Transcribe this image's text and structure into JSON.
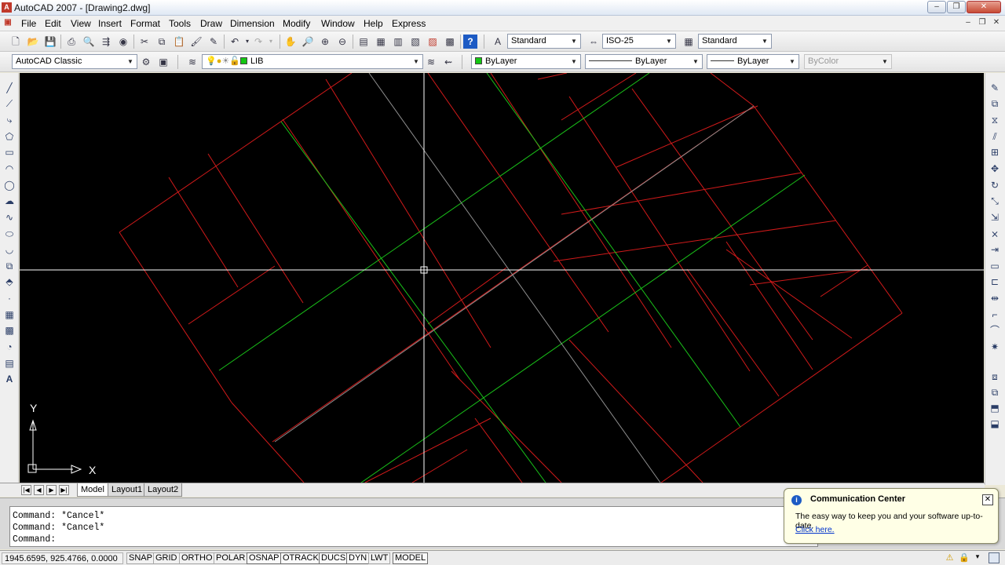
{
  "window": {
    "title": "AutoCAD 2007 - [Drawing2.dwg]",
    "app_icon_glyph": "A",
    "buttons": [
      "–",
      "❐",
      "✕"
    ],
    "mdi_buttons": [
      "–",
      "❐",
      "✕"
    ]
  },
  "menu": {
    "items": [
      "File",
      "Edit",
      "View",
      "Insert",
      "Format",
      "Tools",
      "Draw",
      "Dimension",
      "Modify",
      "Window",
      "Help",
      "Express"
    ]
  },
  "toolbar1": {
    "text_style": "Standard",
    "dim_style": "ISO-25",
    "table_style": "Standard"
  },
  "toolbar2": {
    "workspace": "AutoCAD Classic",
    "layer": "LIB",
    "color": "ByLayer",
    "color_swatch": "#13c713",
    "linetype": "ByLayer",
    "lineweight": "ByLayer",
    "plotstyle": "ByColor"
  },
  "drawing": {
    "background": "#000000",
    "red_color": "#d11a1a",
    "green_color": "#19c119",
    "gray_color": "#8f8f8f",
    "ucs_x": "X",
    "ucs_y": "Y"
  },
  "tabs": {
    "nav": [
      "|◀",
      "◀",
      "▶",
      "▶|"
    ],
    "items": [
      "Model",
      "Layout1",
      "Layout2"
    ],
    "active": "Model"
  },
  "command": {
    "lines": [
      "Command: *Cancel*",
      "Command: *Cancel*",
      "Command:"
    ]
  },
  "status": {
    "coordinates": "1945.6595, 925.4766, 0.0000",
    "buttons": [
      "SNAP",
      "GRID",
      "ORTHO",
      "POLAR",
      "OSNAP",
      "OTRACK",
      "DUCS",
      "DYN",
      "LWT",
      "MODEL"
    ]
  },
  "communication_center": {
    "title": "Communication Center",
    "body": "The easy way to keep you and your software up-to-date.",
    "link": "Click here.",
    "close_glyph": "✕",
    "info_glyph": "i"
  }
}
